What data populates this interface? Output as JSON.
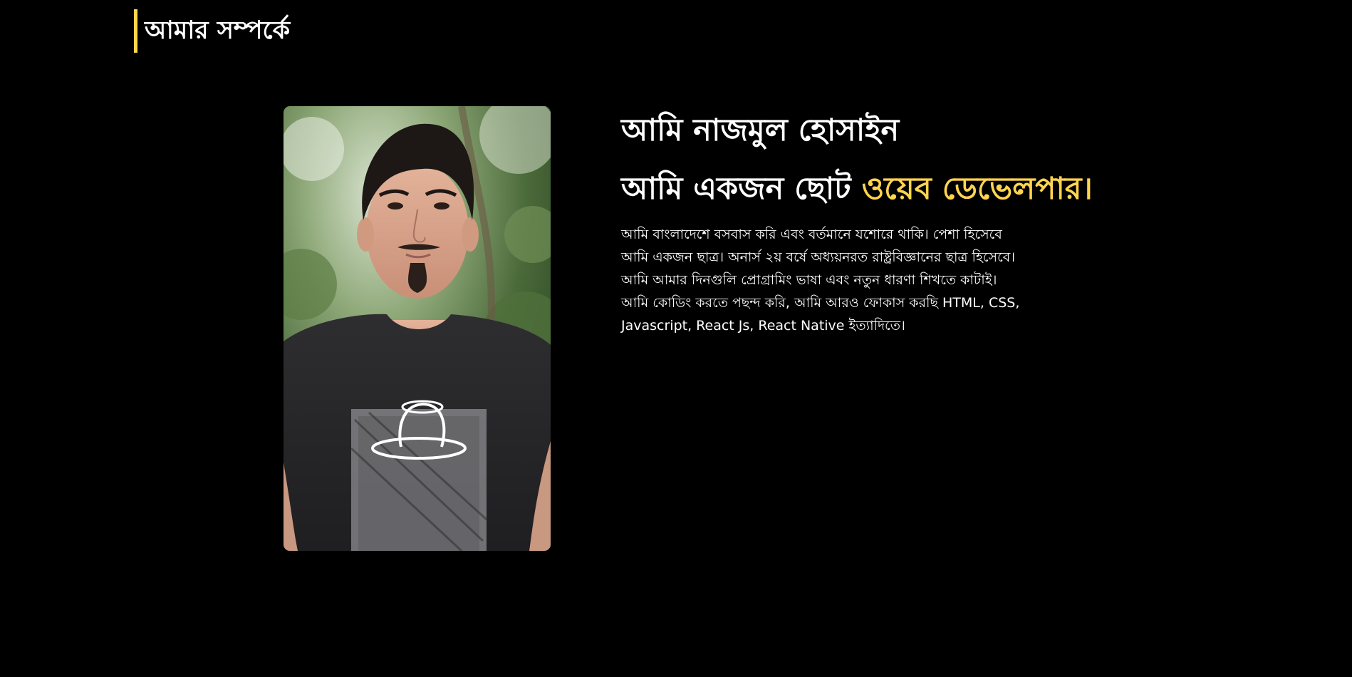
{
  "section": {
    "title": "আমার সম্পর্কে"
  },
  "profile": {
    "photo_alt": "portrait-photo"
  },
  "intro": {
    "name_line": "আমি নাজমুল হোসাইন",
    "role_prefix": "আমি একজন ছোট ",
    "role_highlight": "ওয়েব ডেভেলপার।",
    "bio": "আমি বাংলাদেশে বসবাস করি এবং বর্তমানে যশোরে থাকি। পেশা হিসেবে আমি একজন ছাত্র। অনার্স ২য় বর্ষে অধ্যয়নরত রাষ্ট্রবিজ্ঞানের ছাত্র হিসেবে। আমি আমার দিনগুলি প্রোগ্রামিং ভাষা এবং নতুন ধারণা শিখতে কাটাই। আমি কোডিং করতে পছন্দ করি, আমি আরও ফোকাস করছি HTML, CSS, Javascript, React Js, React Native ইত্যাদিতে।"
  },
  "colors": {
    "background": "#000000",
    "accent": "#ffd54f",
    "text": "#ffffff"
  }
}
